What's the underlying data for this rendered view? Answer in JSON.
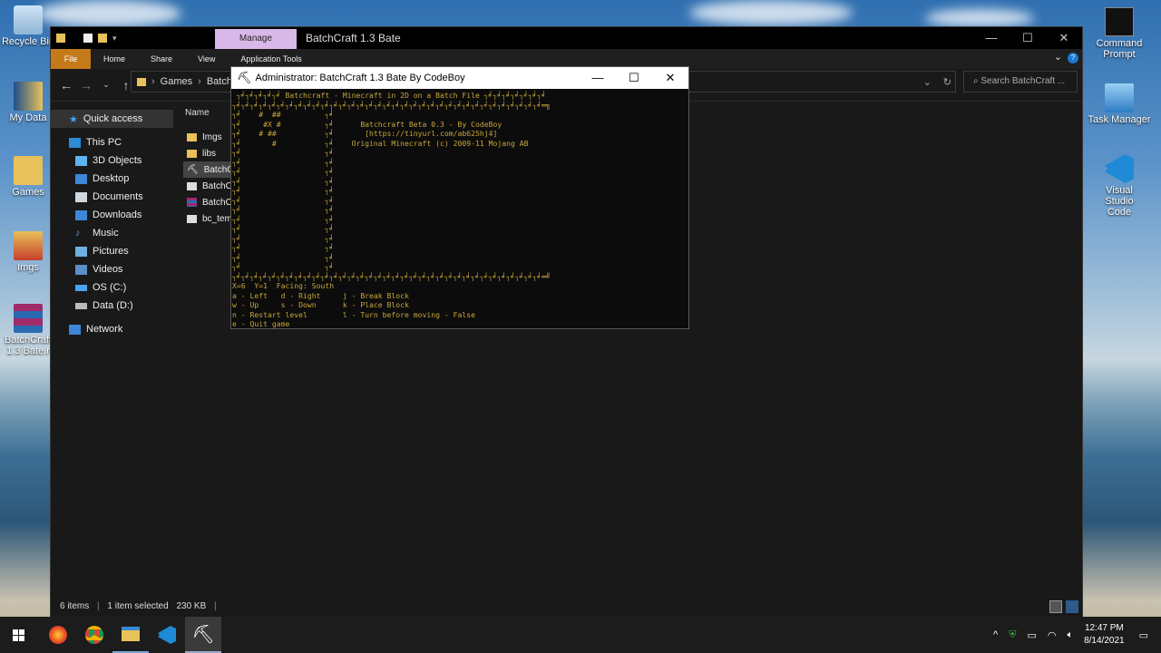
{
  "desktop": {
    "icons_left": [
      {
        "label": "Recycle Bin",
        "icon": "recycle-bin-icon"
      },
      {
        "label": "My Data",
        "icon": "user-folder-icon"
      },
      {
        "label": "Games",
        "icon": "folder-icon"
      },
      {
        "label": "Imgs",
        "icon": "folder-icon"
      },
      {
        "label": "BatchCraft 1.3 Bate.r",
        "icon": "winrar-archive-icon"
      }
    ],
    "icons_right": [
      {
        "label": "Command Prompt",
        "icon": "terminal-icon"
      },
      {
        "label": "Task Manager",
        "icon": "task-manager-icon"
      },
      {
        "label": "Visual Studio Code",
        "icon": "vscode-icon"
      }
    ]
  },
  "explorer": {
    "manage_tab": "Manage",
    "title": "BatchCraft 1.3 Bate",
    "ribbon_tabs": [
      "File",
      "Home",
      "Share",
      "View",
      "Application Tools"
    ],
    "breadcrumb": [
      "Games",
      "BatchC"
    ],
    "search_placeholder": "Search BatchCraft ...",
    "nav": {
      "quick_access": "Quick access",
      "this_pc": "This PC",
      "items": [
        "3D Objects",
        "Desktop",
        "Documents",
        "Downloads",
        "Music",
        "Pictures",
        "Videos",
        "OS (C:)",
        "Data (D:)"
      ],
      "network": "Network"
    },
    "column_name": "Name",
    "files": [
      "Imgs",
      "libs",
      "BatchC",
      "BatchC",
      "BatchC",
      "bc_tem"
    ],
    "status": {
      "items": "6 items",
      "selected": "1 item selected",
      "size": "230 KB"
    }
  },
  "console": {
    "title": "Administrator:  BatchCraft 1.3 Bate By CodeBoy",
    "lines": [
      " ┐╛┐╛┐╛┐╛┐╛ Batchcraft - Minecraft in 2D on a Batch File ┐╛┐╛┐╛┐╛┐╛┐╛┐╛",
      "┐╛┐╛┐╛┐╛┐╛┐╛┐╛┐╛┐╛┐╛┐╛┐╛┐╛┐╛┐╛┐╛┐╛┐╛┐╛┐╛┐╛┐╛┐╛┐╛┐╛┐╛┐╛┐╛┐╛┐╛┐╛┐╛┐╛┐╛┐╛═╗",
      "┐╛    #  ##          ┐╛",
      "┐╛     #X #          ┐╛      Batchcraft Beta 0.3 - By CodeBoy",
      "┐╛    # ##           ┐╛       [https://tinyurl.com/ab625hj4]",
      "┐╛       #           ┐╛    Original Minecraft (c) 2009-11 Mojang AB",
      "┐╛                   ┐╛",
      "┐╛                   ┐╛",
      "┐╛                   ┐╛",
      "┐╛                   ┐╛",
      "┐╛                   ┐╛",
      "┐╛                   ┐╛",
      "┐╛                   ┐╛",
      "┐╛                   ┐╛",
      "┐╛                   ┐╛",
      "┐╛                   ┐╛",
      "┐╛                   ┐╛",
      "┐╛                   ┐╛",
      "┐╛                   ┐╛",
      "┐╛┐╛┐╛┐╛┐╛┐╛┐╛┐╛┐╛┐╛┐╛┐╛┐╛┐╛┐╛┐╛┐╛┐╛┐╛┐╛┐╛┐╛┐╛┐╛┐╛┐╛┐╛┐╛┐╛┐╛┐╛┐╛┐╛┐╛┐╛═╝",
      "X=6  Y=1  Facing: South",
      "a - Left   d - Right     j - Break Block",
      "w - Up     s - Down      k - Place Block",
      "n - Restart level        l - Turn before moving - False",
      "e - Quit game"
    ]
  },
  "taskbar": {
    "apps": [
      "start-icon",
      "firefox-icon",
      "chrome-icon",
      "file-explorer-icon",
      "vscode-icon",
      "batchcraft-icon"
    ],
    "time": "12:47 PM",
    "date": "8/14/2021"
  }
}
